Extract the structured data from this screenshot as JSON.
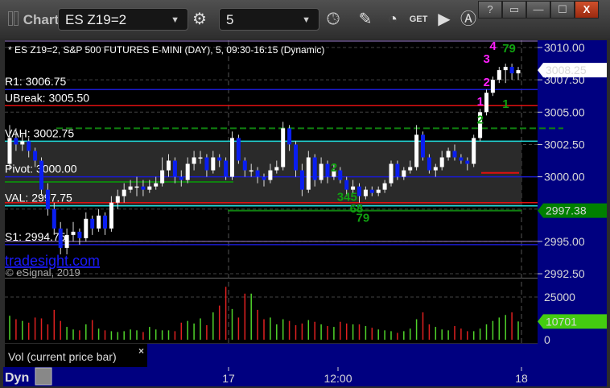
{
  "window": {
    "title": "Chart",
    "help": "?",
    "buttons": [
      "?",
      "▭",
      "—",
      "☐",
      "X"
    ]
  },
  "toolbar": {
    "symbol": "ES Z19=2",
    "interval": "5"
  },
  "chart_header": "* ES Z19=2, S&P 500 FUTURES E-MINI (DAY), 5, 09:30-16:15 (Dynamic)",
  "watermark": {
    "brand": "tradesight.com",
    "copyright": "© eSignal, 2019"
  },
  "colors": {
    "up": "#ffffff",
    "down": "#0a1ef0",
    "vol_up": "#4fd32a",
    "vol_down": "#e02020",
    "axis_bg": "#000080",
    "last_price_tag": "#ffffff",
    "level_tag": "#008000"
  },
  "levels": [
    {
      "label": "R1: 3006.75",
      "price": 3006.75,
      "color": "#1a1ad0"
    },
    {
      "label": "UBreak: 3005.50",
      "price": 3005.5,
      "color": "#e01010"
    },
    {
      "label": "VAH: 3002.75",
      "price": 3002.75,
      "color": "#20e0e0"
    },
    {
      "label": "Pivot: 3000.00",
      "price": 3000.0,
      "color": "#1a1ad0"
    },
    {
      "label": "VAL: 2997.75",
      "price": 2997.75,
      "color": "#20e0e0"
    },
    {
      "label": "S1: 2994.75",
      "price": 2994.75,
      "color": "#1a1ad0"
    }
  ],
  "chart_data": {
    "type": "candlestick",
    "title": "* ES Z19=2, S&P 500 FUTURES E-MINI (DAY), 5, 09:30-16:15 (Dynamic)",
    "ylim": [
      2992.5,
      3010.5
    ],
    "y_ticks": [
      "3010.00",
      "3007.50",
      "3005.00",
      "3002.50",
      "3000.00",
      "2995.00",
      "2992.50"
    ],
    "y_tick_values": [
      3010,
      3007.5,
      3005,
      3002.5,
      3000,
      2995,
      2992.5
    ],
    "x_ticks": [
      "17",
      "12:00",
      "18"
    ],
    "last_price": "3008.25",
    "level_tag": "2997.38",
    "ohlc": [
      [
        3001,
        3004,
        3000.5,
        3003
      ],
      [
        3003,
        3003.75,
        3002,
        3002.5
      ],
      [
        3002.5,
        3003.25,
        3002,
        3002.75
      ],
      [
        3002.75,
        3003,
        3001.5,
        3002
      ],
      [
        3002,
        3002.25,
        3000.75,
        3001.25
      ],
      [
        3001.25,
        3001.5,
        2998.5,
        2999
      ],
      [
        2999,
        2999.5,
        2997,
        2997.5
      ],
      [
        2997.5,
        2998,
        2995.5,
        2996
      ],
      [
        2996,
        2996.5,
        2994,
        2994.5
      ],
      [
        2994.5,
        2996,
        2994,
        2995.5
      ],
      [
        2995.5,
        2996.5,
        2995,
        2995.75
      ],
      [
        2995.75,
        2996,
        2994.75,
        2995.25
      ],
      [
        2995.25,
        2997.25,
        2995,
        2996.75
      ],
      [
        2996.75,
        2997,
        2995.5,
        2996
      ],
      [
        2996,
        2997.5,
        2995.75,
        2997
      ],
      [
        2997,
        2997.25,
        2995.5,
        2996
      ],
      [
        2996,
        2998.5,
        2995.75,
        2998
      ],
      [
        2998,
        2999,
        2997.5,
        2998.5
      ],
      [
        2998.5,
        2999.5,
        2998,
        2999
      ],
      [
        2999,
        2999.75,
        2998.75,
        2999.25
      ],
      [
        2999.25,
        3000,
        2998.5,
        2999.25
      ],
      [
        2999.25,
        2999.75,
        2998.5,
        2999
      ],
      [
        2999,
        2999.75,
        2998.75,
        2999.25
      ],
      [
        2999.25,
        3000,
        2999,
        2999.5
      ],
      [
        2999.5,
        3001.5,
        2999.25,
        3000.5
      ],
      [
        3000.5,
        3001.75,
        3000,
        3001.25
      ],
      [
        3001.25,
        3001.5,
        2999.5,
        3000
      ],
      [
        3000,
        3000.5,
        2999.25,
        2999.75
      ],
      [
        2999.75,
        3001.5,
        2999.5,
        3001
      ],
      [
        3001,
        3002,
        3000.5,
        3001.5
      ],
      [
        3001.5,
        3002,
        3001,
        3001.5
      ],
      [
        3001.5,
        3001.75,
        3000,
        3000.5
      ],
      [
        3000.5,
        3002,
        3000.25,
        3001.5
      ],
      [
        3001.5,
        3001.75,
        3000.75,
        3001.25
      ],
      [
        3001.25,
        3001.5,
        2999.75,
        3000
      ],
      [
        3000,
        3003.5,
        2999.75,
        3003
      ],
      [
        3003,
        3003.25,
        3001,
        3001.25
      ],
      [
        3001.25,
        3001.5,
        3000,
        3000.5
      ],
      [
        3000.5,
        3001,
        3000,
        3000.5
      ],
      [
        3000.5,
        3000.75,
        2999.5,
        3000
      ],
      [
        3000,
        3000.25,
        2999.25,
        2999.75
      ],
      [
        2999.75,
        3001,
        2999.5,
        3000.5
      ],
      [
        3000.5,
        3001.25,
        3000.25,
        3000.75
      ],
      [
        3000.75,
        3004.25,
        3000.5,
        3003.75
      ],
      [
        3003.75,
        3004,
        3002,
        3002.5
      ],
      [
        3002.5,
        3002.75,
        3000,
        3000.5
      ],
      [
        3000.5,
        3001,
        2998.5,
        2999
      ],
      [
        2999,
        3002,
        2998.75,
        3001.5
      ],
      [
        3001.5,
        3001.75,
        2999.25,
        2999.75
      ],
      [
        2999.75,
        3001.5,
        2999.5,
        3001
      ],
      [
        3001,
        3001.25,
        2999.5,
        3000
      ],
      [
        3000,
        3001,
        2999.75,
        3000.5
      ],
      [
        3000.5,
        3000.75,
        2999.5,
        2999.75
      ],
      [
        2999.75,
        3000,
        2998.5,
        2999
      ],
      [
        2999,
        2999.75,
        2998.75,
        2999.25
      ],
      [
        2999.25,
        2999.5,
        2998,
        2998.5
      ],
      [
        2998.5,
        2999.25,
        2998.25,
        2999
      ],
      [
        2999,
        2999.25,
        2998.5,
        2998.75
      ],
      [
        2998.75,
        2999.25,
        2998.5,
        2999
      ],
      [
        2999,
        2999.75,
        2998.75,
        2999.5
      ],
      [
        2999.5,
        3001.25,
        2999.25,
        3001
      ],
      [
        3001,
        3001.25,
        2999.75,
        3000
      ],
      [
        3000,
        3000.75,
        2999.75,
        3000.5
      ],
      [
        3000.5,
        3001.25,
        3000.25,
        3000.75
      ],
      [
        3000.75,
        3004,
        3000.5,
        3003.25
      ],
      [
        3003.25,
        3003.5,
        3001.25,
        3001.5
      ],
      [
        3001.5,
        3001.75,
        3000.25,
        3000.5
      ],
      [
        3000.5,
        3001,
        3000,
        3000.75
      ],
      [
        3000.75,
        3002,
        3000.5,
        3001.5
      ],
      [
        3001.5,
        3002.25,
        3001.25,
        3002
      ],
      [
        3002,
        3002.5,
        3001.25,
        3001.5
      ],
      [
        3001.5,
        3001.75,
        3001,
        3001.25
      ],
      [
        3001.25,
        3001.5,
        3000.5,
        3001
      ],
      [
        3001,
        3003.25,
        3000.75,
        3003
      ],
      [
        3003,
        3005.25,
        3002.75,
        3005
      ],
      [
        3005,
        3006.75,
        3004.75,
        3006.5
      ],
      [
        3006.5,
        3007.75,
        3006.25,
        3007.5
      ],
      [
        3007.5,
        3008.5,
        3007.25,
        3008.25
      ],
      [
        3008.25,
        3008.75,
        3007.25,
        3008.5
      ],
      [
        3008.5,
        3008.75,
        3007.5,
        3008
      ],
      [
        3008,
        3008.5,
        3007.5,
        3008.25
      ]
    ],
    "volume": {
      "label": "Vol (current price bar)",
      "y_ticks": [
        "25000",
        "0"
      ],
      "y_tick_values": [
        25000,
        0
      ],
      "last": "10701",
      "ylim": [
        0,
        33000
      ],
      "values": [
        14000,
        12000,
        11000,
        10000,
        13000,
        12500,
        9000,
        17500,
        11000,
        7500,
        6000,
        5500,
        9000,
        11500,
        6500,
        5500,
        5000,
        4500,
        5000,
        6000,
        5500,
        4500,
        7500,
        6000,
        5500,
        5500,
        5000,
        10000,
        11000,
        9500,
        12500,
        8500,
        16000,
        20000,
        31000,
        18000,
        13000,
        27000,
        27000,
        17500,
        12000,
        13000,
        9000,
        12000,
        11000,
        8500,
        9500,
        11500,
        10500,
        9000,
        8000,
        7500,
        10500,
        9500,
        9000,
        9000,
        8000,
        7000,
        6000,
        5500,
        5000,
        4000,
        5000,
        6500,
        12000,
        16000,
        9000,
        7500,
        6000,
        5500,
        8000,
        6500,
        5000,
        5000,
        6500,
        9000,
        11000,
        13000,
        14500,
        16000,
        10701
      ]
    }
  },
  "annotations": [
    {
      "text": "4",
      "price": 3010.2,
      "bar": 76,
      "color": "#ff20ff"
    },
    {
      "text": "3",
      "price": 3009.2,
      "bar": 75,
      "color": "#ff20ff"
    },
    {
      "text": "2",
      "price": 3007.4,
      "bar": 75,
      "color": "#ff20ff"
    },
    {
      "text": "1",
      "price": 3005.9,
      "bar": 74,
      "color": "#ff20ff"
    },
    {
      "text": "79",
      "price": 3010,
      "bar": 78,
      "color": "#10a010"
    },
    {
      "text": "2",
      "price": 3004.5,
      "bar": 74,
      "color": "#10a010"
    },
    {
      "text": "1",
      "price": 3005.7,
      "bar": 78,
      "color": "#10a010"
    },
    {
      "text": "2",
      "price": 3000.8,
      "bar": 51,
      "color": "#10a010"
    },
    {
      "text": "345",
      "price": 2998.5,
      "bar": 52,
      "color": "#10a010"
    },
    {
      "text": "68",
      "price": 2997.6,
      "bar": 54,
      "color": "#10a010"
    },
    {
      "text": "79",
      "price": 2996.9,
      "bar": 55,
      "color": "#10a010"
    }
  ],
  "footer": {
    "mode": "Dyn"
  }
}
